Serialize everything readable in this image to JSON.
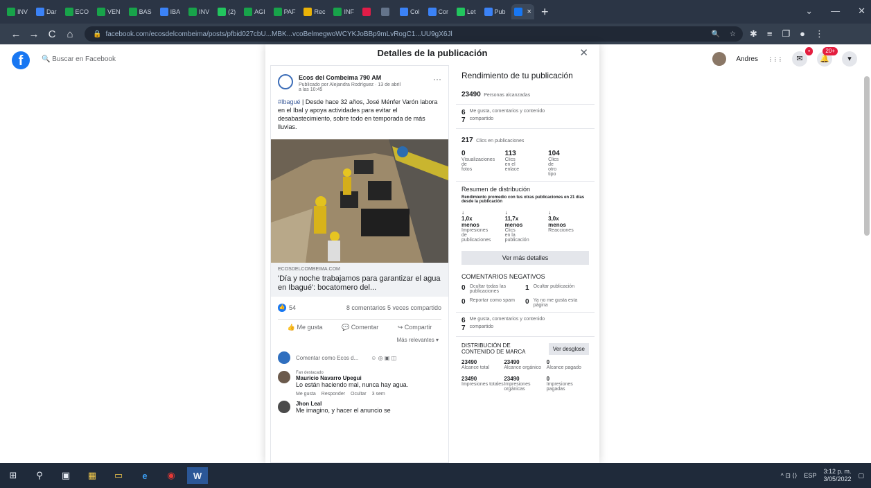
{
  "browser": {
    "tabs": [
      {
        "label": "INV",
        "color": "#18a34a"
      },
      {
        "label": "Dar",
        "color": "#3b82f6"
      },
      {
        "label": "ECO",
        "color": "#18a34a"
      },
      {
        "label": "VEN",
        "color": "#18a34a"
      },
      {
        "label": "BAS",
        "color": "#18a34a"
      },
      {
        "label": "IBA",
        "color": "#3b82f6"
      },
      {
        "label": "INV",
        "color": "#18a34a"
      },
      {
        "label": "(2)",
        "color": "#22c55e"
      },
      {
        "label": "AGI",
        "color": "#18a34a"
      },
      {
        "label": "PAF",
        "color": "#18a34a"
      },
      {
        "label": "Rec",
        "color": "#eab308"
      },
      {
        "label": "INF",
        "color": "#18a34a"
      },
      {
        "label": "",
        "color": "#e11d48"
      },
      {
        "label": "",
        "color": "#64748b"
      },
      {
        "label": "Col",
        "color": "#3b82f6"
      },
      {
        "label": "Cor",
        "color": "#3b82f6"
      },
      {
        "label": "Let",
        "color": "#22c55e"
      },
      {
        "label": "Pub",
        "color": "#3b82f6"
      },
      {
        "label": "",
        "color": "#1877f2"
      }
    ],
    "new_tab": "+",
    "window_controls": [
      "⌄",
      "—",
      "✕"
    ],
    "nav": {
      "back": "←",
      "forward": "→",
      "reload": "C",
      "home": "⌂"
    },
    "url": "facebook.com/ecosdelcombeima/posts/pfbid027cbU...MBK...vcoBelmegwoWCYKJoBBp9mLvRogC1...UU9gX6Jl",
    "omnibox_icons": [
      "🔍",
      "☆"
    ],
    "extensions": [
      "✱",
      "≡",
      "❐",
      "●",
      "⋮"
    ]
  },
  "fb": {
    "logo": "f",
    "search_placeholder": "Buscar en Facebook",
    "user_name": "Andres",
    "menu_icon": "⋮⋮⋮",
    "messenger_badge": "",
    "notif_badge": "20+"
  },
  "modal": {
    "title": "Detalles de la publicación",
    "close": "✕",
    "post": {
      "page_name": "Ecos del Combeima 790 AM",
      "published_by": "Publicado por Alejandra Rodríguez · 13 de abril a las 10:45",
      "dots": "···",
      "tag": "#Ibagué",
      "text": " | Desde hace 32 años, José Ménfer Varón labora en el Ibal y apoya actividades para evitar el desabastecimiento, sobre todo en temporada de más lluvias.",
      "link_domain": "ECOSDELCOMBEIMA.COM",
      "link_title": "'Día y noche trabajamos para garantizar el agua en Ibagué': bocatomero del...",
      "reactions": "54",
      "stats": "8 comentarios  5 veces compartido",
      "actions": [
        "Me gusta",
        "Comentar",
        "Compartir"
      ],
      "relevance": "Más relevantes ▾",
      "comment_placeholder": "Comentar como Ecos d...",
      "comments": [
        {
          "fan": "Fan destacado",
          "name": "Mauricio Navarro Upegui",
          "text": "Lo están haciendo mal, nunca hay agua.",
          "actions": [
            "Me gusta",
            "Responder",
            "Ocultar",
            "3 sem"
          ]
        },
        {
          "fan": "",
          "name": "Jhon Leal",
          "text": "Me imagino, y hacer el anuncio se",
          "actions": []
        }
      ]
    },
    "metrics": {
      "title": "Rendimiento de tu publicación",
      "reach": "23490",
      "reach_label": "Personas alcanzadas",
      "likes_num": "6",
      "likes_label": "Me gusta, comentarios y contenido",
      "shares_num": "7",
      "shares_label": "compartido",
      "clicks": "217",
      "clicks_label": "Clics en publicaciones",
      "grid": [
        {
          "num": "0",
          "label": "Visualizaciones de fotos"
        },
        {
          "num": "113",
          "label": "Clics en el enlace"
        },
        {
          "num": "104",
          "label": "Clics de otro tipo"
        }
      ],
      "dist_title": "Resumen de distribución",
      "dist_text": "Rendimiento promedio con tus otras publicaciones en 21 días desde la publicación",
      "dist": [
        {
          "num": "↓ 1,0x menos",
          "label": "Impresiones de publicaciones"
        },
        {
          "num": "↓ 11,7x menos",
          "label": "Clics en la publicación"
        },
        {
          "num": "↓ 3,0x menos",
          "label": "Reacciones"
        }
      ],
      "more_btn": "Ver más detalles",
      "neg_title": "COMENTARIOS NEGATIVOS",
      "neg": [
        {
          "num": "0",
          "label": "Ocultar todas las publicaciones"
        },
        {
          "num": "1",
          "label": "Ocultar publicación"
        },
        {
          "num": "0",
          "label": "Reportar como spam"
        },
        {
          "num": "0",
          "label": "Ya no me gusta esta página"
        }
      ],
      "likes2_num": "6",
      "likes2_label": "Me gusta, comentarios y contenido",
      "shares2_num": "7",
      "shares2_label": "compartido",
      "brand_title": "DISTRIBUCIÓN DE CONTENIDO DE MARCA",
      "brand_btn": "Ver desglose",
      "brand": [
        {
          "num": "23490",
          "label": "Alcance total"
        },
        {
          "num": "23490",
          "label": "Alcance orgánico"
        },
        {
          "num": "0",
          "label": "Alcance pagado"
        },
        {
          "num": "23490",
          "label": "Impresiones totales"
        },
        {
          "num": "23490",
          "label": "Impresiones orgánicas"
        },
        {
          "num": "0",
          "label": "Impresiones pagadas"
        }
      ]
    }
  },
  "taskbar": {
    "start": "⊞",
    "search": "⚲",
    "apps": [
      "▣",
      "▦",
      "▭",
      "e",
      "◉",
      "W"
    ],
    "tray_lang": "ESP",
    "time": "3:12 p. m.",
    "date": "3/05/2022",
    "tray_icons": "^  ⊡  ⟨⟩"
  }
}
